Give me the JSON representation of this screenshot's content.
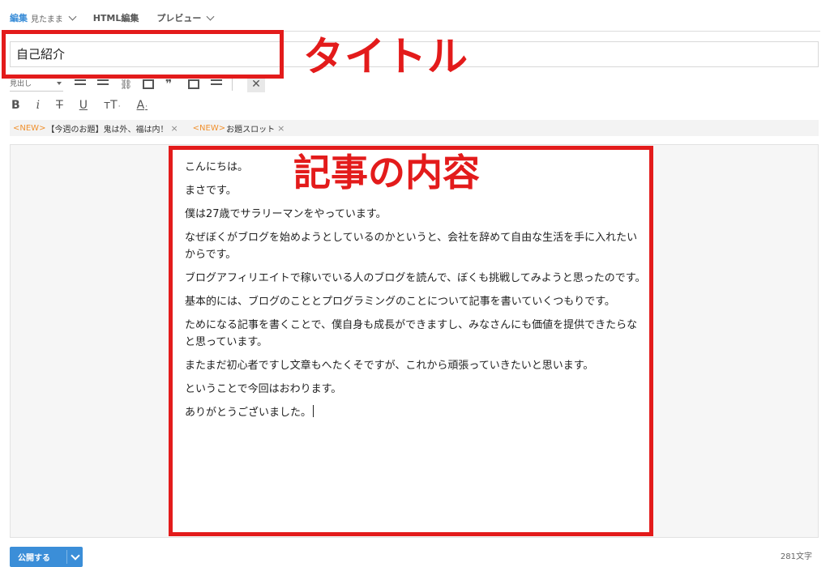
{
  "mode_tabs": {
    "edit": {
      "label": "編集",
      "sub": "見たまま"
    },
    "html": {
      "label": "HTML編集"
    },
    "preview": {
      "label": "プレビュー"
    }
  },
  "title_field": {
    "value": "自己紹介"
  },
  "annotations": {
    "title_label": "タイトル",
    "content_label": "記事の内容",
    "color": "#e31b1b"
  },
  "toolbar": {
    "heading_select": "見出し",
    "icons": [
      "bulleted-list-icon",
      "numbered-list-icon",
      "link-icon",
      "table-icon",
      "quote-icon",
      "image-list-icon",
      "toc-icon",
      "close-toolbar-icon"
    ],
    "close_glyph": "✕"
  },
  "format": {
    "bold": "B",
    "italic": "i",
    "strike": "T",
    "underline": "U",
    "size": "тT",
    "color": "A"
  },
  "topics": [
    {
      "tag": "<NEW>",
      "text": "【今週のお題】鬼は外、福は内！",
      "close": "×"
    },
    {
      "tag": "<NEW>",
      "text": "お題スロット",
      "close": "×"
    }
  ],
  "article": {
    "paragraphs": [
      "こんにちは。",
      "まさです。",
      "僕は27歳でサラリーマンをやっています。",
      "なぜぼくがブログを始めようとしているのかというと、会社を辞めて自由な生活を手に入れたいからです。",
      "ブログアフィリエイトで稼いでいる人のブログを読んで、ぼくも挑戦してみようと思ったのです。",
      "基本的には、ブログのこととプログラミングのことについて記事を書いていくつもりです。",
      "ためになる記事を書くことで、僕自身も成長ができますし、みなさんにも価値を提供できたらなと思っています。",
      "またまだ初心者ですし文章もへたくそですが、これから頑張っていきたいと思います。",
      "ということで今回はおわります。",
      "ありがとうございました。"
    ]
  },
  "footer": {
    "publish_label": "公開する",
    "char_count": "281文字"
  },
  "colors": {
    "accent": "#3b8ed8",
    "new_tag": "#f0912f"
  }
}
